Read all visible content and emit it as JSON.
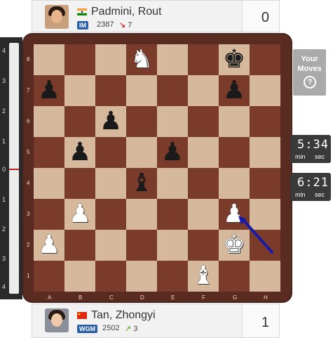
{
  "top_player": {
    "name": "Padmini, Rout",
    "flag": "India",
    "title": "IM",
    "rating": "2387",
    "rating_change": "7",
    "score": "0"
  },
  "bottom_player": {
    "name": "Tan, Zhongyi",
    "flag": "China",
    "title": "WGM",
    "rating": "2502",
    "rating_change": "3",
    "score": "1"
  },
  "eval_bar": {
    "labels_top": [
      "4",
      "3",
      "2",
      "1",
      "0"
    ],
    "labels_bottom": [
      "1",
      "2",
      "3",
      "4"
    ]
  },
  "board": {
    "ranks": [
      "8",
      "7",
      "6",
      "5",
      "4",
      "3",
      "2",
      "1"
    ],
    "files": [
      "A",
      "B",
      "C",
      "D",
      "E",
      "F",
      "G",
      "H"
    ],
    "pieces": [
      {
        "square": "d8",
        "piece": "knight",
        "color": "white",
        "glyph": "♞"
      },
      {
        "square": "g8",
        "piece": "king",
        "color": "black",
        "glyph": "♚"
      },
      {
        "square": "a7",
        "piece": "pawn",
        "color": "black",
        "glyph": "♟"
      },
      {
        "square": "g7",
        "piece": "pawn",
        "color": "black",
        "glyph": "♟"
      },
      {
        "square": "c6",
        "piece": "pawn",
        "color": "black",
        "glyph": "♟"
      },
      {
        "square": "b5",
        "piece": "pawn",
        "color": "black",
        "glyph": "♟"
      },
      {
        "square": "e5",
        "piece": "pawn",
        "color": "black",
        "glyph": "♟"
      },
      {
        "square": "d4",
        "piece": "bishop",
        "color": "black",
        "glyph": "♝"
      },
      {
        "square": "b3",
        "piece": "pawn",
        "color": "white",
        "glyph": "♟"
      },
      {
        "square": "g3",
        "piece": "pawn",
        "color": "white",
        "glyph": "♟"
      },
      {
        "square": "a2",
        "piece": "pawn",
        "color": "white",
        "glyph": "♟"
      },
      {
        "square": "g2",
        "piece": "king",
        "color": "white",
        "glyph": "♚"
      },
      {
        "square": "f1",
        "piece": "bishop",
        "color": "white",
        "glyph": "♝"
      }
    ],
    "arrow": {
      "from": "h2",
      "to": "g3",
      "color": "#1a1aa8"
    }
  },
  "your_moves": {
    "line1": "Your",
    "line2": "Moves",
    "help": "?"
  },
  "clocks": [
    {
      "time": "5:34",
      "unit_min": "min",
      "unit_sec": "sec"
    },
    {
      "time": "6:21",
      "unit_min": "min",
      "unit_sec": "sec"
    }
  ]
}
